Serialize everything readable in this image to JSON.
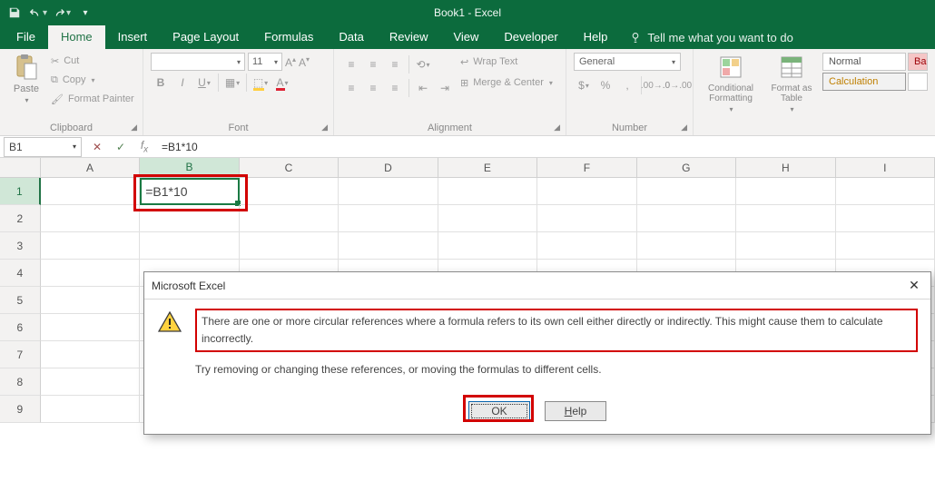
{
  "titlebar": {
    "title": "Book1 - Excel"
  },
  "tabs": {
    "file": "File",
    "items": [
      "Home",
      "Insert",
      "Page Layout",
      "Formulas",
      "Data",
      "Review",
      "View",
      "Developer",
      "Help"
    ],
    "active": "Home",
    "tellme": "Tell me what you want to do"
  },
  "ribbon": {
    "clipboard": {
      "paste": "Paste",
      "cut": "Cut",
      "copy": "Copy",
      "fmtpainter": "Format Painter",
      "label": "Clipboard"
    },
    "font": {
      "name": "",
      "size": "11",
      "label": "Font"
    },
    "alignment": {
      "wrap": "Wrap Text",
      "merge": "Merge & Center",
      "label": "Alignment"
    },
    "number": {
      "format": "General",
      "label": "Number"
    },
    "styles": {
      "cond": "Conditional Formatting",
      "table": "Format as Table",
      "normal": "Normal",
      "bad": "Ba",
      "calc": "Calculation"
    }
  },
  "fxbar": {
    "name": "B1",
    "formula": "=B1*10"
  },
  "grid": {
    "columns": [
      "A",
      "B",
      "C",
      "D",
      "E",
      "F",
      "G",
      "H",
      "I"
    ],
    "rows": [
      "1",
      "2",
      "3",
      "4",
      "5",
      "6",
      "7",
      "8",
      "9"
    ],
    "active_cell_value": "=B1*10",
    "active_col": "B",
    "active_row": "1"
  },
  "dialog": {
    "title": "Microsoft Excel",
    "message": "There are one or more circular references where a formula refers to its own cell either directly or indirectly. This might cause them to calculate incorrectly.",
    "hint": "Try removing or changing these references, or moving the formulas to different cells.",
    "ok": "OK",
    "help": "Help"
  }
}
